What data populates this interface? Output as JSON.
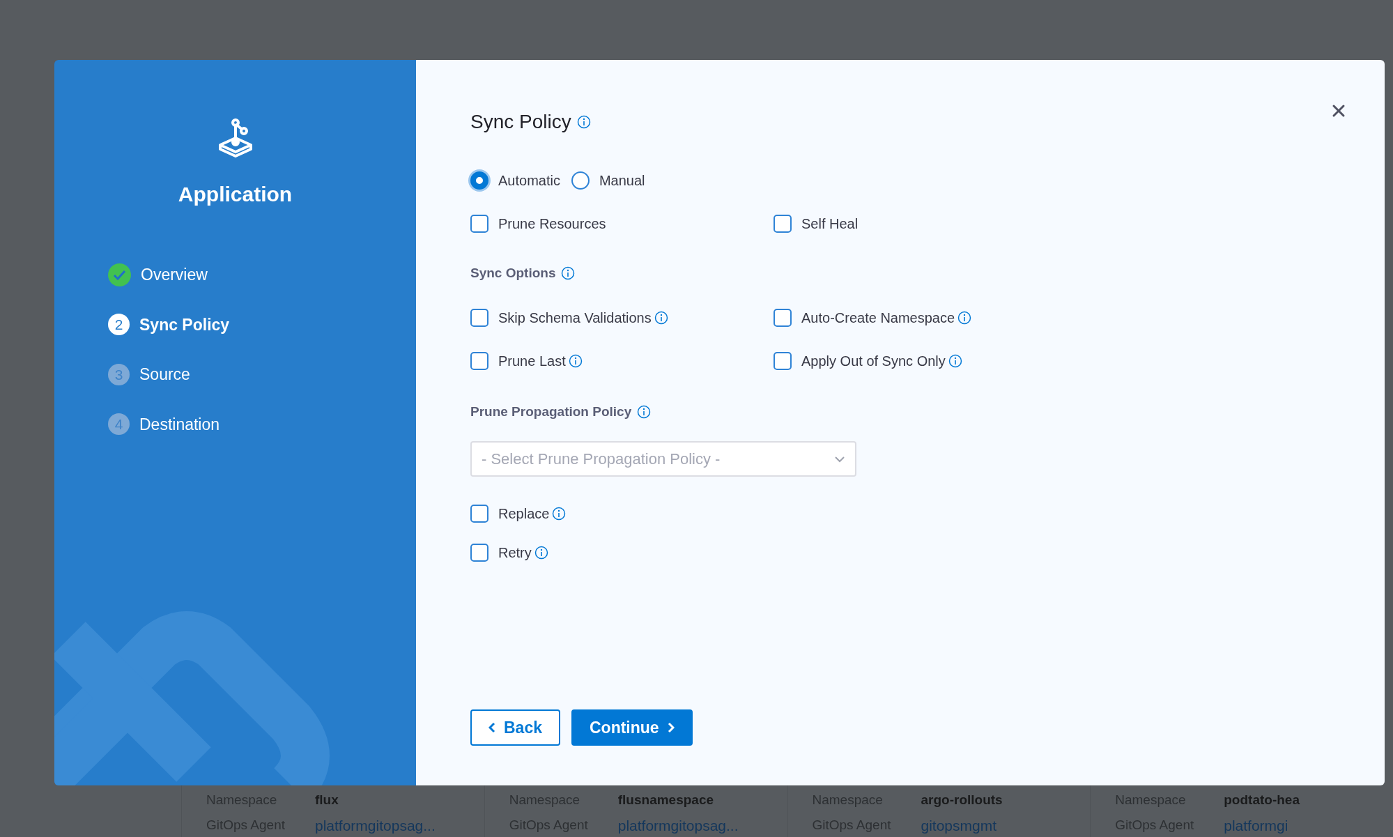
{
  "background_cards": [
    {
      "namespace_label": "Namespace",
      "namespace": "flux",
      "agent_label": "GitOps Agent",
      "agent": "platformgitopsag..."
    },
    {
      "namespace_label": "Namespace",
      "namespace": "flusnamespace",
      "agent_label": "GitOps Agent",
      "agent": "platformgitopsag..."
    },
    {
      "namespace_label": "Namespace",
      "namespace": "argo-rollouts",
      "agent_label": "GitOps Agent",
      "agent": "gitopsmgmt"
    },
    {
      "namespace_label": "Namespace",
      "namespace": "podtato-hea",
      "agent_label": "GitOps Agent",
      "agent": "platformgi"
    }
  ],
  "wizard": {
    "title": "Application",
    "steps": [
      {
        "label": "Overview",
        "completed": true,
        "selected": false
      },
      {
        "number": "2",
        "label": "Sync Policy",
        "completed": false,
        "selected": true
      },
      {
        "number": "3",
        "label": "Source",
        "completed": false,
        "selected": false
      },
      {
        "number": "4",
        "label": "Destination",
        "completed": false,
        "selected": false
      }
    ]
  },
  "form": {
    "title": "Sync Policy",
    "sync_mode": [
      {
        "label": "Automatic",
        "selected": true
      },
      {
        "label": "Manual",
        "selected": false
      }
    ],
    "policy_options": [
      {
        "label": "Prune Resources",
        "checked": false
      },
      {
        "label": "Self Heal",
        "checked": false
      }
    ],
    "sync_options_label": "Sync Options",
    "sync_options": [
      {
        "label": "Skip Schema Validations",
        "checked": false,
        "info": true
      },
      {
        "label": "Auto-Create Namespace",
        "checked": false,
        "info": true
      },
      {
        "label": "Prune Last",
        "checked": false,
        "info": true
      },
      {
        "label": "Apply Out of Sync Only",
        "checked": false,
        "info": true
      }
    ],
    "prune_propagation_label": "Prune Propagation Policy",
    "prune_propagation_select": {
      "placeholder": "- Select Prune Propagation Policy -"
    },
    "extra_options": [
      {
        "label": "Replace",
        "checked": false,
        "info": true
      },
      {
        "label": "Retry",
        "checked": false,
        "info": true
      }
    ],
    "buttons": [
      {
        "label": "Back",
        "kind": "back"
      },
      {
        "label": "Continue",
        "kind": "continue"
      }
    ]
  }
}
